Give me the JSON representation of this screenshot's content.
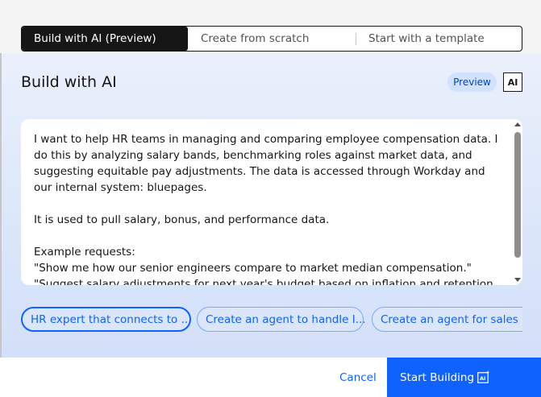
{
  "tabs": [
    {
      "label": "Build with AI (Preview)",
      "active": true
    },
    {
      "label": "Create from scratch",
      "active": false
    },
    {
      "label": "Start with a template",
      "active": false
    }
  ],
  "header": {
    "title": "Build with AI",
    "preview_tag": "Preview",
    "ai_badge": "AI"
  },
  "description": {
    "text": "I want to help HR teams in managing and comparing employee compensation data. I do this by analyzing salary bands, benchmarking roles against market data, and suggesting equitable pay adjustments. The data is accessed through Workday and our internal system: bluepages.\n\nIt is used to pull salary, bonus, and performance data.\n\nExample requests:\n\"Show me how our senior engineers compare to market median compensation.\"\n\"Suggest salary adjustments for next year's budget based on inflation and retention risk.\""
  },
  "suggestions": [
    {
      "label": "HR expert that connects to ..."
    },
    {
      "label": "Create an agent to handle I..."
    },
    {
      "label": "Create an agent for sales m..."
    }
  ],
  "footer": {
    "cancel_label": "Cancel",
    "start_label": "Start Building"
  },
  "colors": {
    "accent": "#0f62fe",
    "tag_bg": "#d0e2ff",
    "active_tab_bg": "#161616"
  },
  "icons": {
    "start_button": "ai-sparkle-icon"
  }
}
